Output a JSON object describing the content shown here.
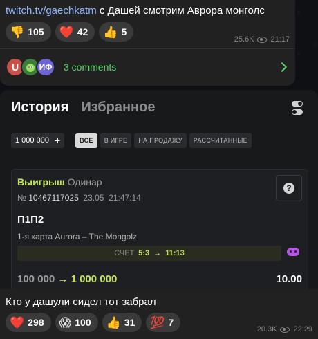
{
  "message1": {
    "link": "twitch.tv/gaechkatm",
    "text": " с Дашей смотрим Аврора монголс",
    "reactions": [
      {
        "emoji": "👎",
        "count": "105"
      },
      {
        "emoji": "❤️",
        "count": "42"
      },
      {
        "emoji": "👍",
        "count": "5"
      }
    ],
    "views": "25.6K",
    "time": "21:17",
    "avatars": [
      "U",
      "",
      "ИФ"
    ],
    "comments": "3 comments"
  },
  "screenshot": {
    "tab_history": "История",
    "tab_favorites": "Избранное",
    "amount": "1 000 000",
    "amount_plus": "+",
    "filters": [
      "ВСЕ",
      "В ИГРЕ",
      "НА ПРОДАЖУ",
      "РАССЧИТАННЫЕ"
    ],
    "bet": {
      "status": "Выигрыш",
      "type": "Одинар",
      "ticket_prefix": "№",
      "ticket": "10467117025",
      "date": "23.05",
      "time": "21:47:14",
      "outcome": "П1П2",
      "match": "1-я карта Aurora – The Mongolz",
      "score_label": "СЧЕТ",
      "score_from": "5:3",
      "score_to": "11:13",
      "stake": "100 000",
      "payout": "1 000 000",
      "odds": "10.00",
      "arrow": "→"
    }
  },
  "message2": {
    "text": "Кто у дашули сидел тот забрал",
    "reactions": [
      {
        "emoji": "❤️",
        "count": "298"
      },
      {
        "emoji": "😱",
        "count": "100"
      },
      {
        "emoji": "👍",
        "count": "31"
      },
      {
        "emoji": "💯",
        "count": "7"
      }
    ],
    "views": "20.3K",
    "time": "22:29"
  }
}
